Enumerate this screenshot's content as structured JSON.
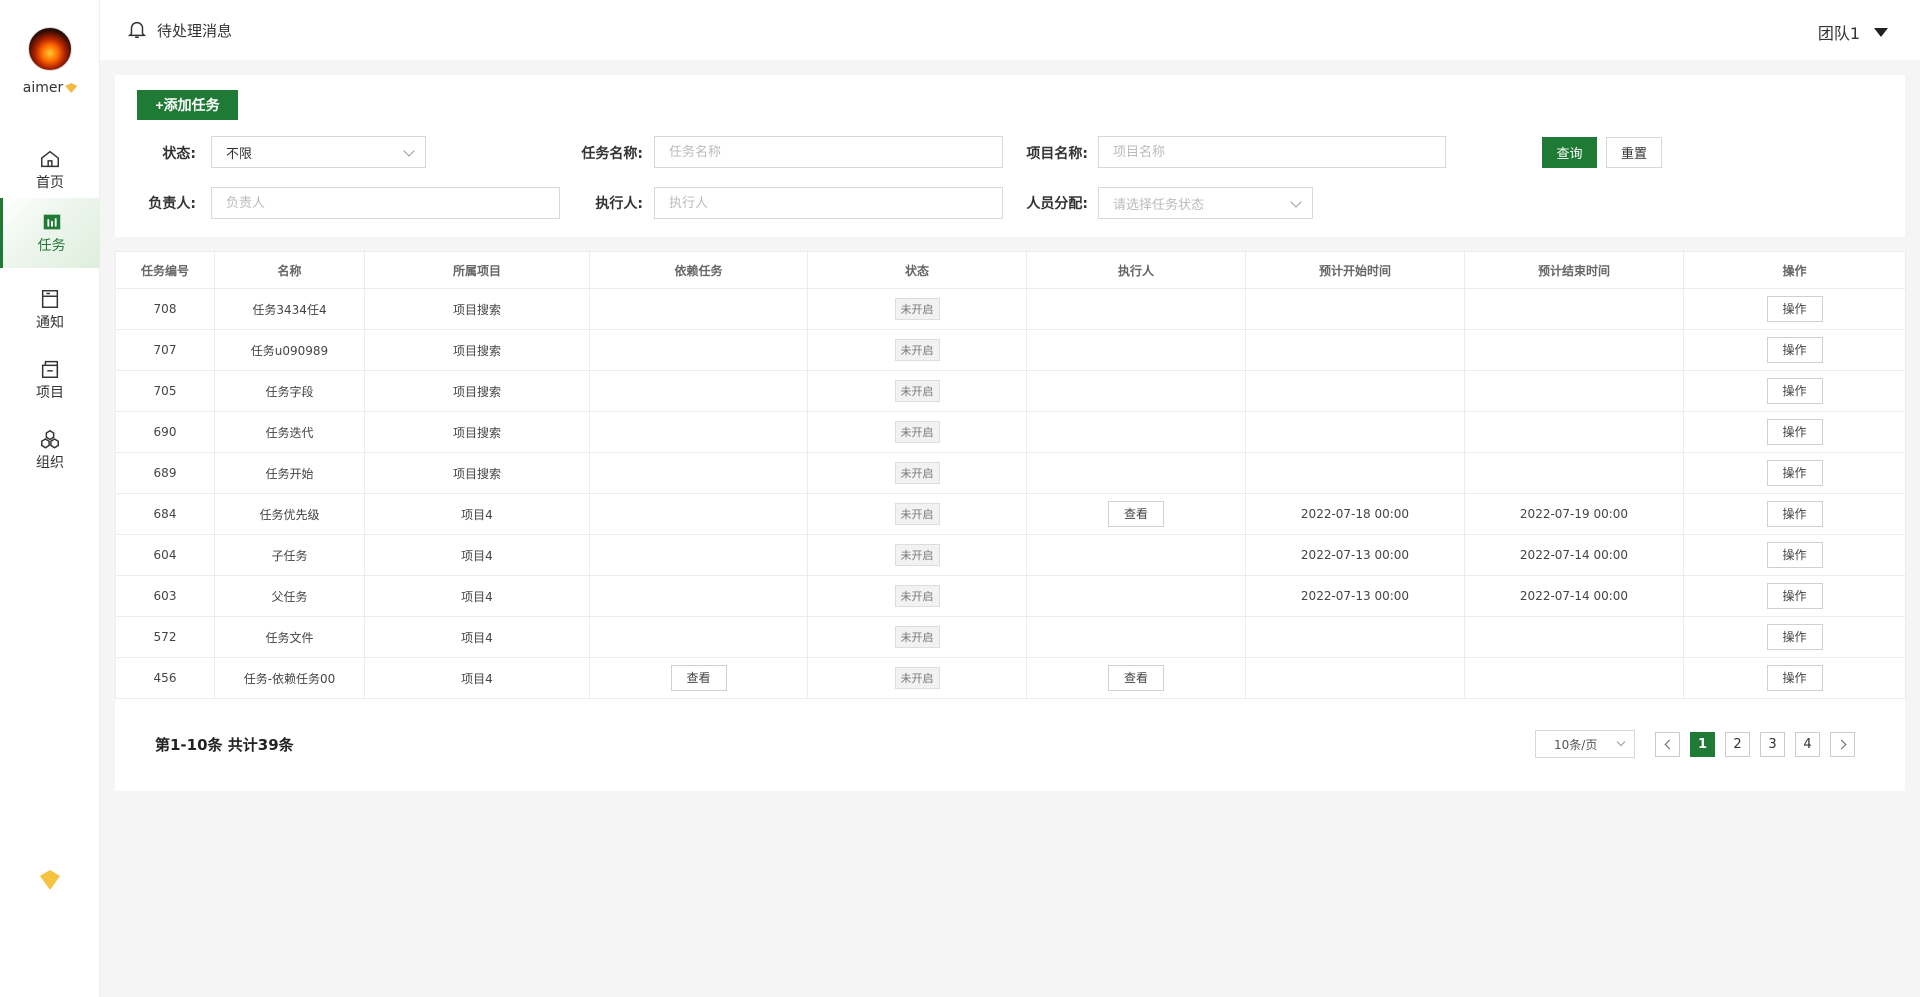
{
  "sidebar": {
    "username": "aimer",
    "items": [
      {
        "label": "首页",
        "icon": "home-icon"
      },
      {
        "label": "任务",
        "icon": "task-icon"
      },
      {
        "label": "通知",
        "icon": "notice-icon"
      },
      {
        "label": "项目",
        "icon": "project-icon"
      },
      {
        "label": "组织",
        "icon": "organization-icon"
      }
    ]
  },
  "topbar": {
    "pending_label": "待处理消息",
    "team_label": "团队1"
  },
  "filters": {
    "add_button": "+添加任务",
    "status_label": "状态:",
    "status_value": "不限",
    "task_name_label": "任务名称:",
    "task_name_placeholder": "任务名称",
    "project_name_label": "项目名称:",
    "project_name_placeholder": "项目名称",
    "owner_label": "负责人:",
    "owner_placeholder": "负责人",
    "executor_label": "执行人:",
    "executor_placeholder": "执行人",
    "assign_label": "人员分配:",
    "assign_placeholder": "请选择任务状态",
    "query_button": "查询",
    "reset_button": "重置"
  },
  "table": {
    "headers": [
      "任务编号",
      "名称",
      "所属项目",
      "依赖任务",
      "状态",
      "执行人",
      "预计开始时间",
      "预计结束时间",
      "操作"
    ],
    "rows": [
      {
        "id": "708",
        "name": "任务3434任4",
        "project": "项目搜索",
        "dep": "",
        "status": "未开启",
        "executor": "",
        "start": "",
        "end": "",
        "op": "操作"
      },
      {
        "id": "707",
        "name": "任务u090989",
        "project": "项目搜索",
        "dep": "",
        "status": "未开启",
        "executor": "",
        "start": "",
        "end": "",
        "op": "操作"
      },
      {
        "id": "705",
        "name": "任务字段",
        "project": "项目搜索",
        "dep": "",
        "status": "未开启",
        "executor": "",
        "start": "",
        "end": "",
        "op": "操作"
      },
      {
        "id": "690",
        "name": "任务迭代",
        "project": "项目搜索",
        "dep": "",
        "status": "未开启",
        "executor": "",
        "start": "",
        "end": "",
        "op": "操作"
      },
      {
        "id": "689",
        "name": "任务开始",
        "project": "项目搜索",
        "dep": "",
        "status": "未开启",
        "executor": "",
        "start": "",
        "end": "",
        "op": "操作"
      },
      {
        "id": "684",
        "name": "任务优先级",
        "project": "项目4",
        "dep": "",
        "status": "未开启",
        "executor": "查看",
        "start": "2022-07-18 00:00",
        "end": "2022-07-19 00:00",
        "op": "操作"
      },
      {
        "id": "604",
        "name": "子任务",
        "project": "项目4",
        "dep": "",
        "status": "未开启",
        "executor": "",
        "start": "2022-07-13 00:00",
        "end": "2022-07-14 00:00",
        "op": "操作"
      },
      {
        "id": "603",
        "name": "父任务",
        "project": "项目4",
        "dep": "",
        "status": "未开启",
        "executor": "",
        "start": "2022-07-13 00:00",
        "end": "2022-07-14 00:00",
        "op": "操作"
      },
      {
        "id": "572",
        "name": "任务文件",
        "project": "项目4",
        "dep": "",
        "status": "未开启",
        "executor": "",
        "start": "",
        "end": "",
        "op": "操作"
      },
      {
        "id": "456",
        "name": "任务-依赖任务00",
        "project": "项目4",
        "dep": "查看",
        "status": "未开启",
        "executor": "查看",
        "start": "",
        "end": "",
        "op": "操作"
      }
    ]
  },
  "pagination": {
    "summary": "第1-10条 共计39条",
    "page_size": "10条/页",
    "pages": [
      "1",
      "2",
      "3",
      "4"
    ],
    "current": "1"
  },
  "colors": {
    "accent": "#1e7a34"
  }
}
